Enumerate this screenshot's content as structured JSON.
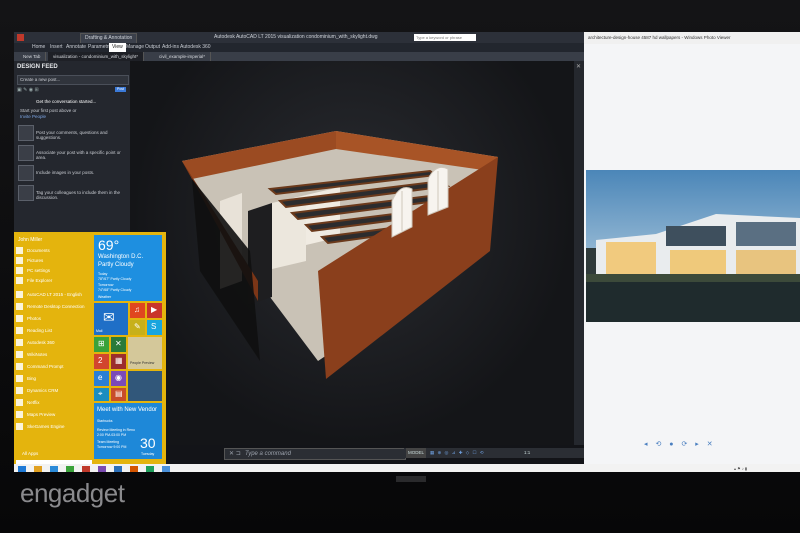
{
  "acad": {
    "workspace": "Drafting & Annotation",
    "title": "Autodesk AutoCAD LT 2015    visualization    condominium_with_skylight.dwg",
    "search_placeholder": "Type a keyword or phrase",
    "ribbon_tabs": [
      "Home",
      "Insert",
      "Annotate",
      "Parametric",
      "View",
      "Manage",
      "Output",
      "Add-ins",
      "Autodesk 360"
    ],
    "ribbon_selected_index": 4,
    "doc_tabs": [
      "New Tab",
      "visualization - condominium_with_skylight*",
      "civil_example-imperial*"
    ],
    "active_doc_tab": 1,
    "feed": {
      "heading": "DESIGN FEED",
      "placeholder": "Create a new post...",
      "post_label": "Post",
      "get_started": "Get the conversation started...",
      "attach_hint": "Start your first post above or",
      "invite": "Invite People",
      "tips": [
        "Post your comments, questions and suggestions.",
        "Associate your post with a specific point or area.",
        "Include images in your posts.",
        "Tag your colleagues to include them in the discussion."
      ]
    },
    "command_label": "✕ ⊐",
    "command_placeholder": "Type a command",
    "model_label": "MODEL",
    "scale_label": "1:1"
  },
  "photo_viewer": {
    "title": "architecture-design-house 4587 hd wallpapers - Windows Photo Viewer"
  },
  "start_menu": {
    "user": "John Miller",
    "items": [
      "Documents",
      "Pictures",
      "PC settings",
      "File Explorer",
      "AutoCAD LT 2015 - English",
      "Remote Desktop Connection",
      "Photos",
      "Reading List",
      "Autodesk 360",
      "WikiNotes",
      "Command Prompt",
      "Bing",
      "Dynamics CRM",
      "Netflix",
      "Maps Preview",
      "SkeGames Engine"
    ],
    "all_apps": "All Apps",
    "weather": {
      "temp": "69°",
      "city": "Washington D.C.",
      "condition": "Partly Cloudy",
      "today_label": "Today",
      "today": "78°/67° Partly Cloudy",
      "tomorrow_label": "Tomorrow",
      "tomorrow": "74°/68° Partly Cloudy",
      "app": "Weather"
    },
    "meeting": {
      "title": "Meet with New Vendor",
      "location": "Starbucks",
      "line1": "Review Meeting in Reno",
      "line2": "2:00 PM-03:00 PM",
      "line3": "Team Meeting",
      "line4": "Tomorrow 9:00 PM",
      "day_number": "30",
      "day_name": "Tuesday"
    },
    "tile_labels": {
      "mail": "Mail",
      "people": "People Preview"
    }
  },
  "watermark": "engadget",
  "colors": {
    "start_accent": "#e4b40d",
    "tile_blue": "#1e8fe0",
    "brick": "#8a3f1c"
  }
}
